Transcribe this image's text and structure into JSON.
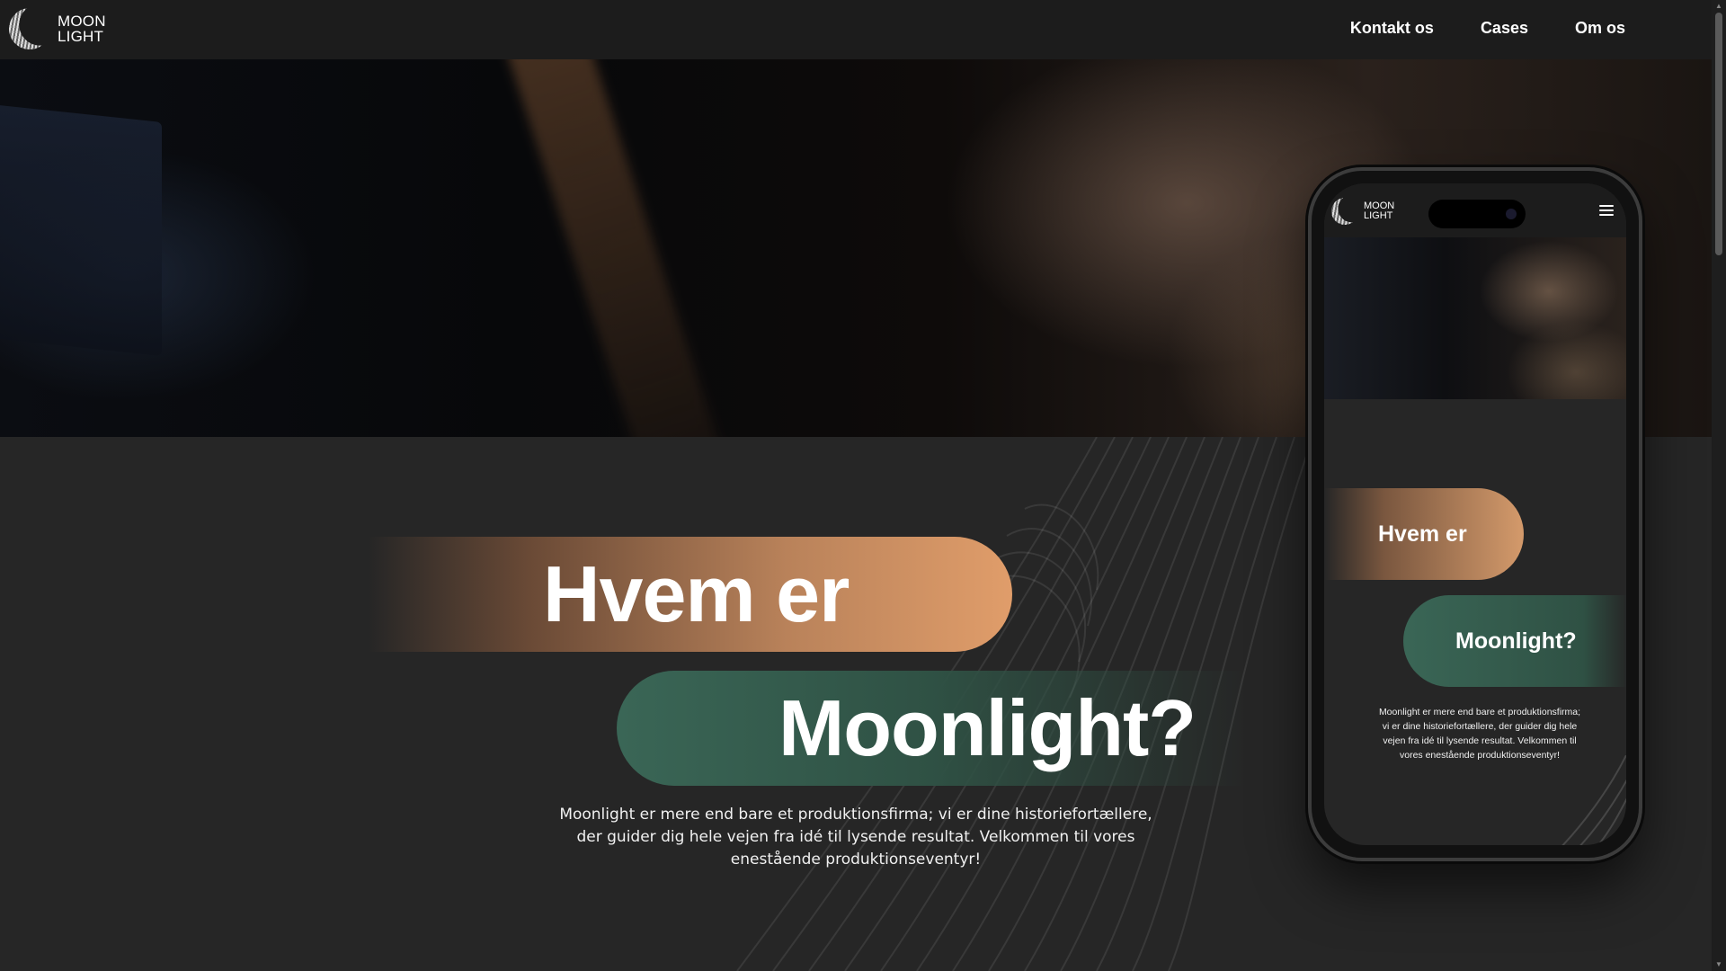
{
  "brand": {
    "logo_line1": "MOON",
    "logo_line2": "LIGHT"
  },
  "nav": {
    "items": [
      "Kontakt os",
      "Cases",
      "Om os"
    ]
  },
  "hero": {
    "headline_line1": "Hvem er",
    "headline_line2": "Moonlight?",
    "intro": "Moonlight er mere end bare et produktionsfirma; vi er dine historiefortællere, der guider dig hele vejen fra idé til lysende resultat. Velkommen til vores enestående produktionseventyr!"
  },
  "phone_mockup": {
    "logo_line1": "MOON",
    "logo_line2": "LIGHT",
    "headline_line1": "Hvem er",
    "headline_line2": "Moonlight?",
    "intro": "Moonlight er mere end bare et produktionsfirma; vi er dine historiefortællere, der guider dig hele vejen fra idé til lysende resultat. Velkommen til vores enestående produktionseventyr!"
  },
  "colors": {
    "background": "#262626",
    "nav_background": "#1c1c1c",
    "accent_orange": "#e09d6a",
    "accent_green": "#3a6656"
  }
}
